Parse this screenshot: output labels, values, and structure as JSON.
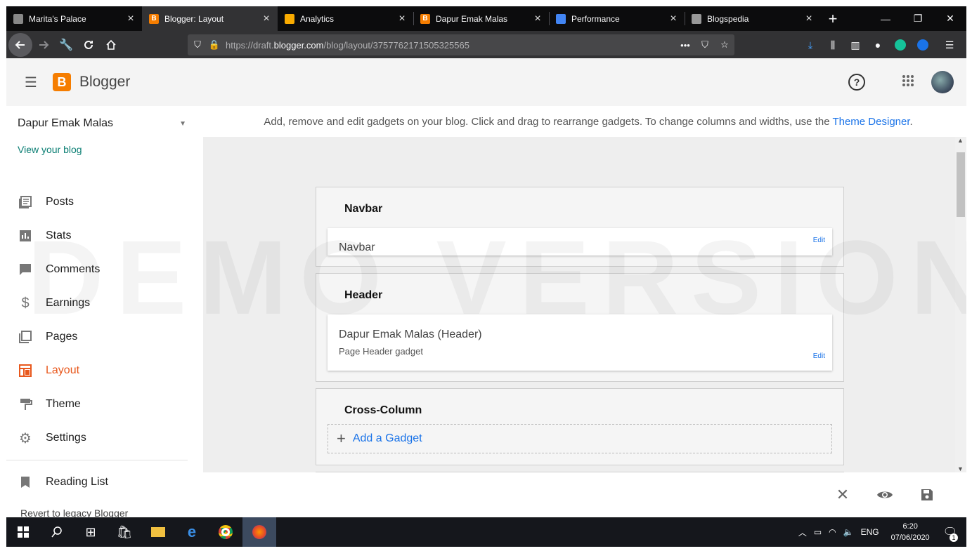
{
  "browser": {
    "tabs": [
      {
        "title": "Marita's Palace",
        "fav_color": "#888888",
        "active": false
      },
      {
        "title": "Blogger: Layout",
        "fav_color": "#f57d00",
        "active": true
      },
      {
        "title": "Analytics",
        "fav_color": "#f9ab00",
        "active": false
      },
      {
        "title": "Dapur Emak Malas",
        "fav_color": "#f57d00",
        "active": false
      },
      {
        "title": "Performance",
        "fav_color": "#4285f4",
        "active": false
      },
      {
        "title": "Blogspedia",
        "fav_color": "#999999",
        "active": false
      }
    ],
    "url_prefix": "https://draft.",
    "url_host": "blogger.com",
    "url_path": "/blog/layout/3757762171505325565"
  },
  "app": {
    "brand": "Blogger",
    "blog_name": "Dapur Emak Malas",
    "view_blog": "View your blog",
    "nav": [
      {
        "label": "Posts",
        "icon": "posts-icon"
      },
      {
        "label": "Stats",
        "icon": "stats-icon"
      },
      {
        "label": "Comments",
        "icon": "comments-icon"
      },
      {
        "label": "Earnings",
        "icon": "earnings-icon"
      },
      {
        "label": "Pages",
        "icon": "pages-icon"
      },
      {
        "label": "Layout",
        "icon": "layout-icon",
        "active": true
      },
      {
        "label": "Theme",
        "icon": "theme-icon"
      },
      {
        "label": "Settings",
        "icon": "settings-icon"
      }
    ],
    "reading_list": "Reading List",
    "legacy": "Revert to legacy Blogger",
    "description": "Add, remove and edit gadgets on your blog. Click and drag to rearrange gadgets. To change columns and widths, use the",
    "theme_designer": "Theme Designer",
    "description_end": ".",
    "watermark": "DEMO VERSION",
    "sections": {
      "navbar": {
        "title": "Navbar",
        "gadget_title": "Navbar",
        "edit": "Edit"
      },
      "header": {
        "title": "Header",
        "gadget_title": "Dapur Emak Malas (Header)",
        "gadget_sub": "Page Header gadget",
        "edit": "Edit"
      },
      "cross": {
        "title": "Cross-Column",
        "add": "Add a Gadget"
      }
    },
    "accent": "#e8581d",
    "link": "#1a73e8"
  },
  "taskbar": {
    "lang": "ENG",
    "time": "6:20",
    "date": "07/06/2020",
    "notifications": "1"
  }
}
